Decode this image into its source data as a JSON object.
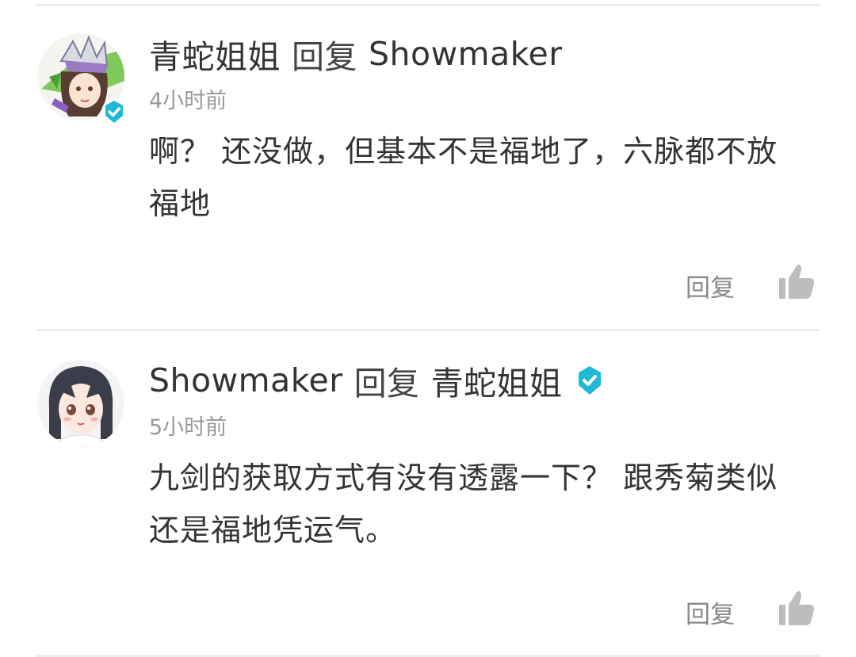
{
  "comments": [
    {
      "author": "青蛇姐姐",
      "reply_word": "回复",
      "target": "Showmaker",
      "time": "4小时前",
      "body": "啊？ 还没做，但基本不是福地了，六脉都不放福地",
      "reply_label": "回复",
      "avatar_icon": "anime-avatar-crowned-girl-icon",
      "verified_icon": "verified-check-icon",
      "verified_position": "avatar"
    },
    {
      "author": "Showmaker",
      "reply_word": "回复",
      "target": "青蛇姐姐",
      "time": "5小时前",
      "body": "九剑的获取方式有没有透露一下？ 跟秀菊类似还是福地凭运气。",
      "reply_label": "回复",
      "avatar_icon": "anime-avatar-dark-haired-girl-icon",
      "verified_icon": "verified-check-icon",
      "verified_position": "name"
    }
  ],
  "colors": {
    "text_primary": "#333333",
    "text_secondary": "#999999",
    "divider": "#ededed",
    "verified": "#1fb9d6",
    "like_icon": "#bdbdbd"
  }
}
